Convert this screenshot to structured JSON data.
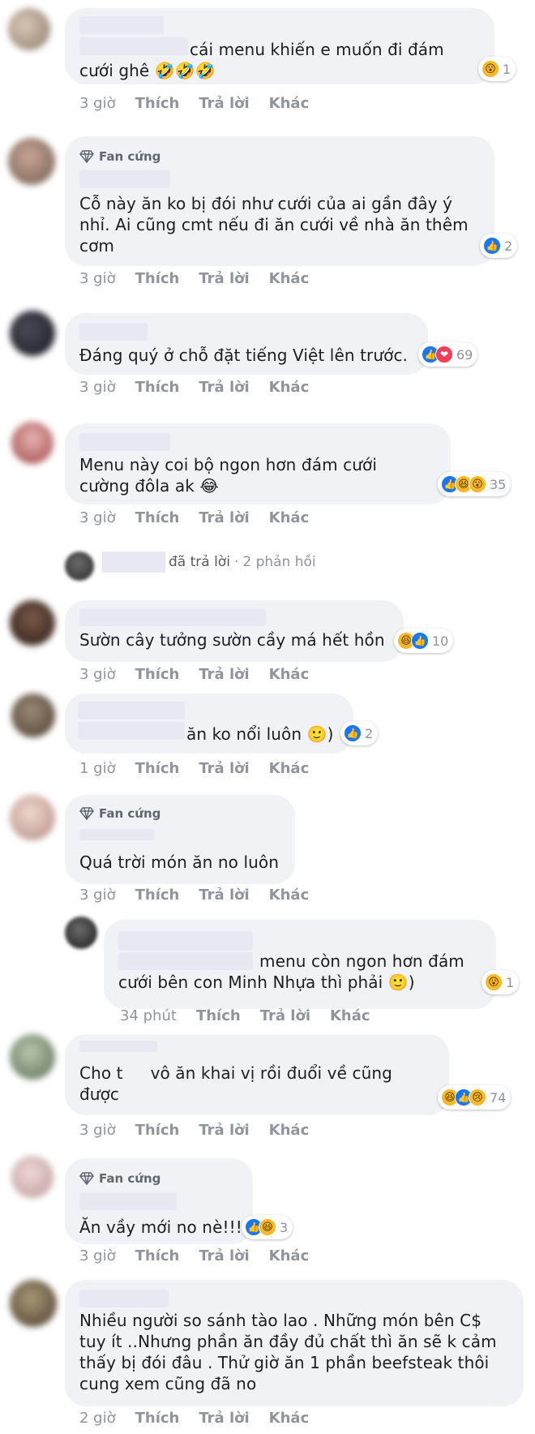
{
  "comments": [
    {
      "id": "c1",
      "badge": null,
      "text": "cái menu khiến e muốn đi đám\ncưới ghê 🤣🤣🤣",
      "reactions": [
        "😮"
      ],
      "count": "1",
      "time": "3 giờ"
    },
    {
      "id": "c2",
      "badge": "Fan cứng",
      "text": "Cỗ này ăn ko bị đói như cưới của ai gần đây ý\nnhỉ. Ai cũng cmt nếu đi ăn cưới về nhà ăn thêm\ncơm",
      "reactions": [
        "👍"
      ],
      "count": "2",
      "time": "3 giờ"
    },
    {
      "id": "c3",
      "badge": null,
      "text": "Đáng quý ở chỗ đặt tiếng Việt lên trước.",
      "reactions": [
        "👍",
        "❤"
      ],
      "count": "69",
      "time": "3 giờ"
    },
    {
      "id": "c4",
      "badge": null,
      "text": "Menu này coi bộ ngon hơn đám cưới\ncường đôla ak 😂",
      "reactions": [
        "👍",
        "😆",
        "😮"
      ],
      "count": "35",
      "time": "3 giờ"
    },
    {
      "id": "c5",
      "badge": null,
      "text": "Sườn cây tưởng sườn cầy má hết hồn",
      "reactions": [
        "😆",
        "👍"
      ],
      "count": "10",
      "time": "3 giờ"
    },
    {
      "id": "c6",
      "badge": null,
      "text": "ăn ko nổi luôn 🙂)",
      "reactions": [
        "👍"
      ],
      "count": "2",
      "time": "1 giờ"
    },
    {
      "id": "c7",
      "badge": "Fan cứng",
      "text": "Quá trời món ăn no luôn",
      "reactions": [],
      "count": "",
      "time": "3 giờ"
    },
    {
      "id": "c8",
      "badge": null,
      "text": "menu còn ngon hơn đám\ncưới bên con Minh Nhựa thì phải 🙂)",
      "reactions": [
        "😮"
      ],
      "count": "1",
      "time": "34 phút"
    },
    {
      "id": "c9",
      "badge": null,
      "text_a": "Cho t",
      "text_b": "vô ăn khai vị rồi đuổi về cũng\nđược",
      "reactions": [
        "😆",
        "👍",
        "😢"
      ],
      "count": "74",
      "time": "3 giờ"
    },
    {
      "id": "c10",
      "badge": "Fan cứng",
      "text": "Ăn vầy mới no nè!!!",
      "reactions": [
        "👍",
        "😆"
      ],
      "count": "3",
      "time": "3 giờ"
    },
    {
      "id": "c11",
      "badge": null,
      "text": "Nhiều người so sánh tào lao . Những món bên C$\ntuy ít ..Nhưng phần ăn đầy đủ chất thì ăn sẽ k cảm\nthấy bị đói đâu . Thử giờ ăn 1 phần beefsteak thôi\ncung xem cũng đã no",
      "reactions": [],
      "count": "",
      "time": "2 giờ"
    }
  ],
  "actions": {
    "like": "Thích",
    "reply": "Trả lời",
    "more": "Khác"
  },
  "reply_summary": {
    "action": "đã trả lời",
    "sep": "·",
    "count": "2 phản hồi"
  }
}
